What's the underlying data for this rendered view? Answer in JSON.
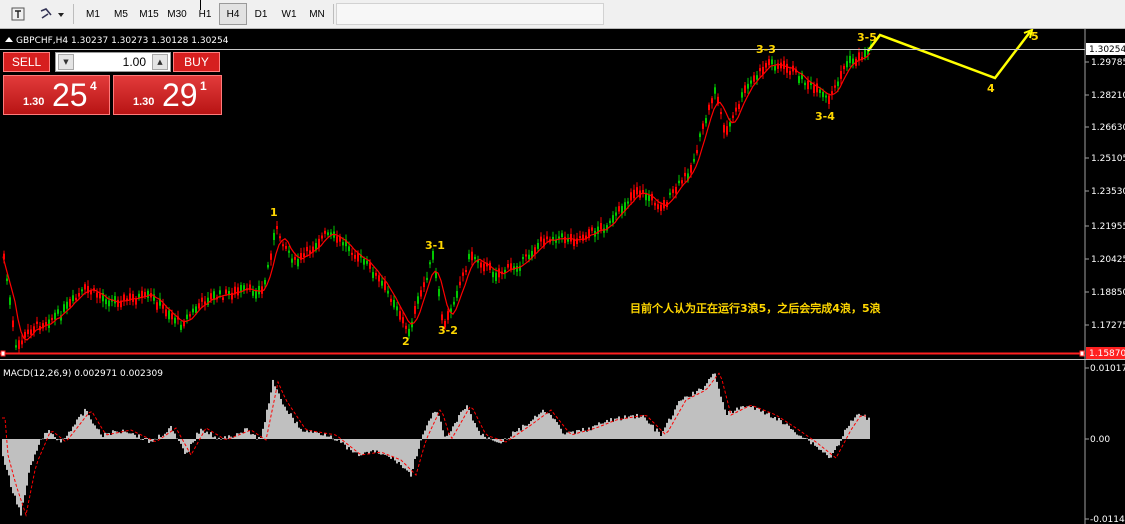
{
  "toolbar": {
    "timeframes": [
      "M1",
      "M5",
      "M15",
      "M30",
      "H1",
      "H4",
      "D1",
      "W1",
      "MN"
    ],
    "active_timeframe": "H4"
  },
  "chart": {
    "header": "GBPCHF,H4  1.30237 1.30273 1.30128 1.30254",
    "price_axis_labels": [
      "1.29785",
      "1.28210",
      "1.26630",
      "1.25105",
      "1.23530",
      "1.21955",
      "1.20425",
      "1.18850",
      "1.17275"
    ],
    "current_price_label": "1.30254",
    "bottom_price_label": "1.15870",
    "wave_labels": [
      "1",
      "2",
      "3-1",
      "3-2",
      "3-3",
      "3-4",
      "3-5",
      "4",
      "5"
    ],
    "annotation": "目前个人认为正在运行3浪5，之后会完成4浪，5浪",
    "colors": {
      "bull_candle": "#00c800",
      "bear_candle": "#ff0000",
      "moving_average": "#ff0000",
      "wave_line": "#ffff00",
      "label": "#ffd700"
    }
  },
  "trade_panel": {
    "sell_label": "SELL",
    "buy_label": "BUY",
    "lot_value": "1.00",
    "sell_price_prefix": "1.30",
    "sell_price_big": "25",
    "sell_price_sup": "4",
    "buy_price_prefix": "1.30",
    "buy_price_big": "29",
    "buy_price_sup": "1"
  },
  "indicator": {
    "label": "MACD(12,26,9) 0.002971 0.002309",
    "axis_labels": [
      "0.010175",
      "0.00",
      "-0.011437"
    ],
    "histogram_color": "#c0c0c0",
    "signal_color": "#ff0000"
  }
}
